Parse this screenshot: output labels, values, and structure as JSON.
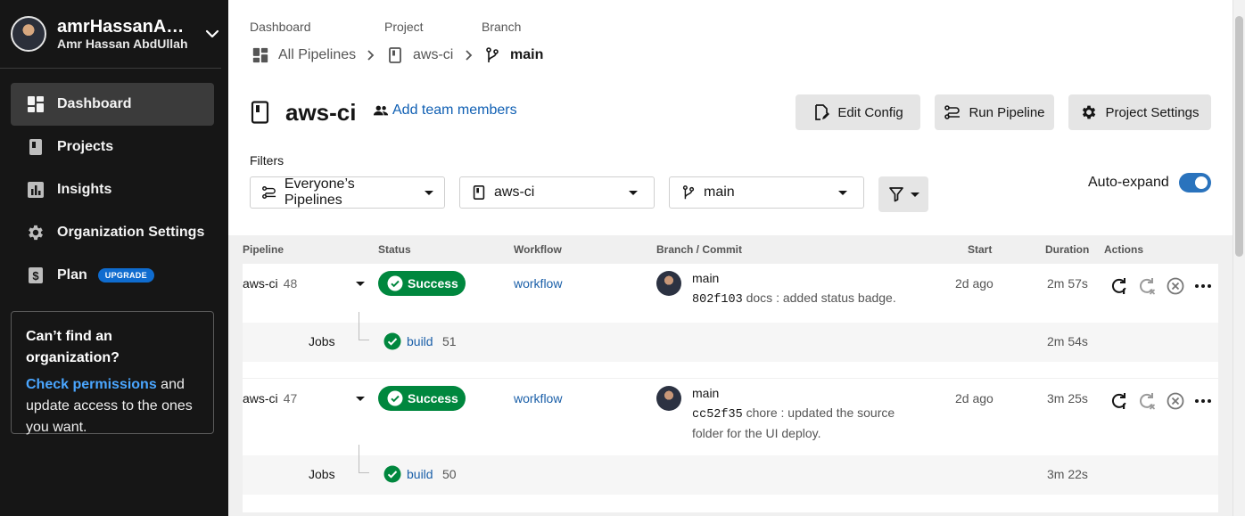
{
  "user": {
    "handle": "amrHassanAb...",
    "full_name": "Amr Hassan AbdUllah"
  },
  "nav": {
    "items": [
      {
        "label": "Dashboard",
        "active": true,
        "icon": "dashboard-icon"
      },
      {
        "label": "Projects",
        "icon": "projects-icon"
      },
      {
        "label": "Insights",
        "icon": "insights-icon"
      },
      {
        "label": "Organization Settings",
        "icon": "gear-icon"
      },
      {
        "label": "Plan",
        "icon": "dollar-icon",
        "badge": "UPGRADE"
      }
    ]
  },
  "org_box": {
    "title": "Can’t find an organization?",
    "link": "Check permissions",
    "text_after_link": " and update access to the ones you want."
  },
  "breadcrumb": {
    "labels": [
      "Dashboard",
      "Project",
      "Branch"
    ],
    "items": [
      "All Pipelines",
      "aws-ci",
      "main"
    ]
  },
  "project": {
    "title": "aws-ci",
    "add_team": "Add team members"
  },
  "toolbar": {
    "edit_config": "Edit Config",
    "run_pipeline": "Run Pipeline",
    "project_settings": "Project Settings"
  },
  "filters": {
    "label": "Filters",
    "pipelines": "Everyone’s Pipelines",
    "project": "aws-ci",
    "branch": "main",
    "auto_expand_label": "Auto-expand",
    "auto_expand_on": true
  },
  "table": {
    "headers": [
      "Pipeline",
      "Status",
      "Workflow",
      "Branch / Commit",
      "Start",
      "Duration",
      "Actions"
    ],
    "jobs_label": "Jobs",
    "rows": [
      {
        "pipeline": "aws-ci",
        "number": "48",
        "status": "Success",
        "workflow": "workflow",
        "branch": "main",
        "commit_hash": "802f103",
        "commit_msg": " docs : added status badge.",
        "start": "2d ago",
        "duration": "2m 57s",
        "job": {
          "name": "build",
          "number": "51",
          "duration": "2m 54s"
        }
      },
      {
        "pipeline": "aws-ci",
        "number": "47",
        "status": "Success",
        "workflow": "workflow",
        "branch": "main",
        "commit_hash": "cc52f35",
        "commit_msg": " chore : updated the source folder for the UI deploy.",
        "start": "2d ago",
        "duration": "3m 25s",
        "job": {
          "name": "build",
          "number": "50",
          "duration": "3m 22s"
        }
      }
    ]
  },
  "colors": {
    "sidebar_bg": "#161616",
    "success": "#00873e",
    "link": "#1a5fa8",
    "toggle": "#2a73bd",
    "upgrade": "#0f6ccf"
  }
}
